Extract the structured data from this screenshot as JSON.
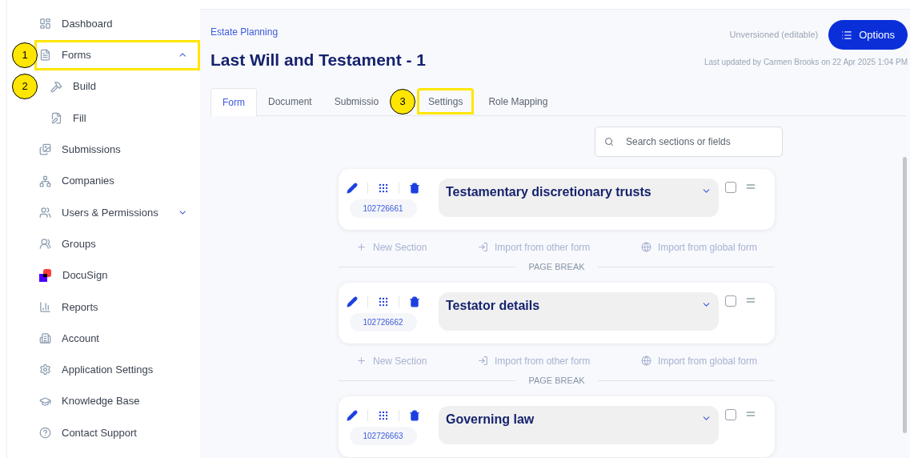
{
  "sidebar": {
    "items": [
      {
        "label": "Dashboard"
      },
      {
        "label": "Forms",
        "expanded": true,
        "highlighted": true,
        "marker": "1",
        "children": [
          {
            "label": "Build",
            "marker": "2"
          },
          {
            "label": "Fill"
          }
        ]
      },
      {
        "label": "Submissions"
      },
      {
        "label": "Companies"
      },
      {
        "label": "Users & Permissions",
        "expanded": false
      },
      {
        "label": "Groups"
      },
      {
        "label": "DocuSign"
      },
      {
        "label": "Reports"
      },
      {
        "label": "Account"
      },
      {
        "label": "Application Settings"
      },
      {
        "label": "Knowledge Base"
      },
      {
        "label": "Contact Support"
      }
    ]
  },
  "header": {
    "breadcrumb": "Estate Planning",
    "title": "Last Will and Testament - 1",
    "status": "Unversioned (editable)",
    "options_button": "Options",
    "last_updated": "Last updated by Carmen Brooks on 22 Apr 2025 1:04 PM"
  },
  "tabs": [
    {
      "label": "Form",
      "selected": true
    },
    {
      "label": "Document",
      "selected": false
    },
    {
      "label": "Submissio",
      "selected": false
    },
    {
      "label": "Settings",
      "selected": false,
      "highlighted": true,
      "marker": "3"
    },
    {
      "label": "Role Mapping",
      "selected": false
    }
  ],
  "search": {
    "placeholder": "Search sections or fields"
  },
  "blocks": [
    {
      "kind": "section",
      "title": "Testamentary discretionary trusts",
      "id": "102726661",
      "checked": false
    },
    {
      "kind": "separator",
      "actions": [
        "New Section",
        "Import from other form",
        "Import from global form"
      ],
      "label": "PAGE BREAK"
    },
    {
      "kind": "section",
      "title": "Testator details",
      "id": "102726662",
      "checked": false
    },
    {
      "kind": "separator",
      "actions": [
        "New Section",
        "Import from other form",
        "Import from global form"
      ],
      "label": "PAGE BREAK"
    },
    {
      "kind": "section",
      "title": "Governing law",
      "id": "102726663",
      "checked": false
    }
  ]
}
